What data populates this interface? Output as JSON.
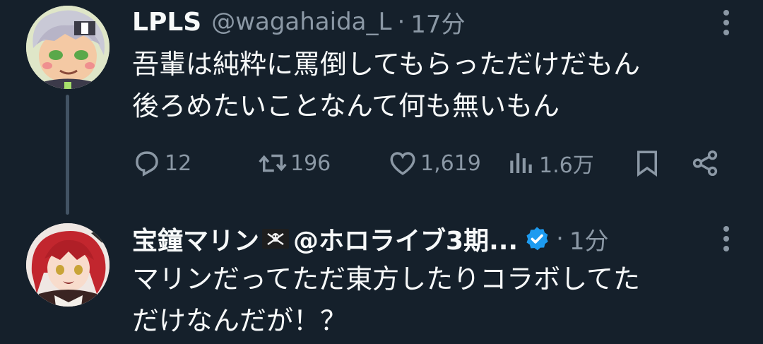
{
  "tweet1": {
    "name": "LPLS",
    "handle": "@wagahaida_L",
    "separator": "·",
    "time": "17分",
    "text": "吾輩は純粋に罵倒してもらっただけだもん\n後ろめたいことなんて何も無いもん",
    "actions": {
      "replies": "12",
      "retweets": "196",
      "likes": "1,619",
      "views": "1.6万"
    },
    "icons": {
      "reply": "reply-icon",
      "retweet": "retweet-icon",
      "like": "heart-icon",
      "views": "views-icon",
      "bookmark": "bookmark-icon",
      "share": "share-icon",
      "more": "more-vertical-icon"
    }
  },
  "tweet2": {
    "name": "宝鐘マリン",
    "handle": "@ホロライブ3期...",
    "separator": "·",
    "time": "1分",
    "text": "マリンだってただ東方したりコラボしてた\nだけなんだが！？",
    "icons": {
      "flag": "pirate-flag-icon",
      "verified": "verified-badge-icon",
      "more": "more-vertical-icon"
    }
  },
  "colors": {
    "background": "#15202b",
    "text": "#f7f9f9",
    "muted": "#8b98a5",
    "verified": "#1d9bf0",
    "thread_line": "#425364"
  }
}
